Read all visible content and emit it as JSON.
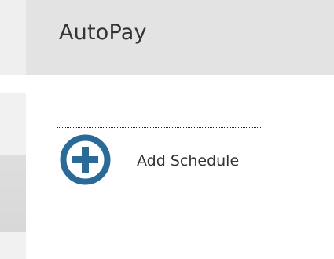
{
  "header": {
    "title": "AutoPay"
  },
  "actions": {
    "add_schedule_label": "Add Schedule",
    "add_icon": "plus-circle-icon"
  },
  "colors": {
    "accent": "#2a6a99",
    "header_bg": "#e3e3e3",
    "text": "#333333"
  }
}
